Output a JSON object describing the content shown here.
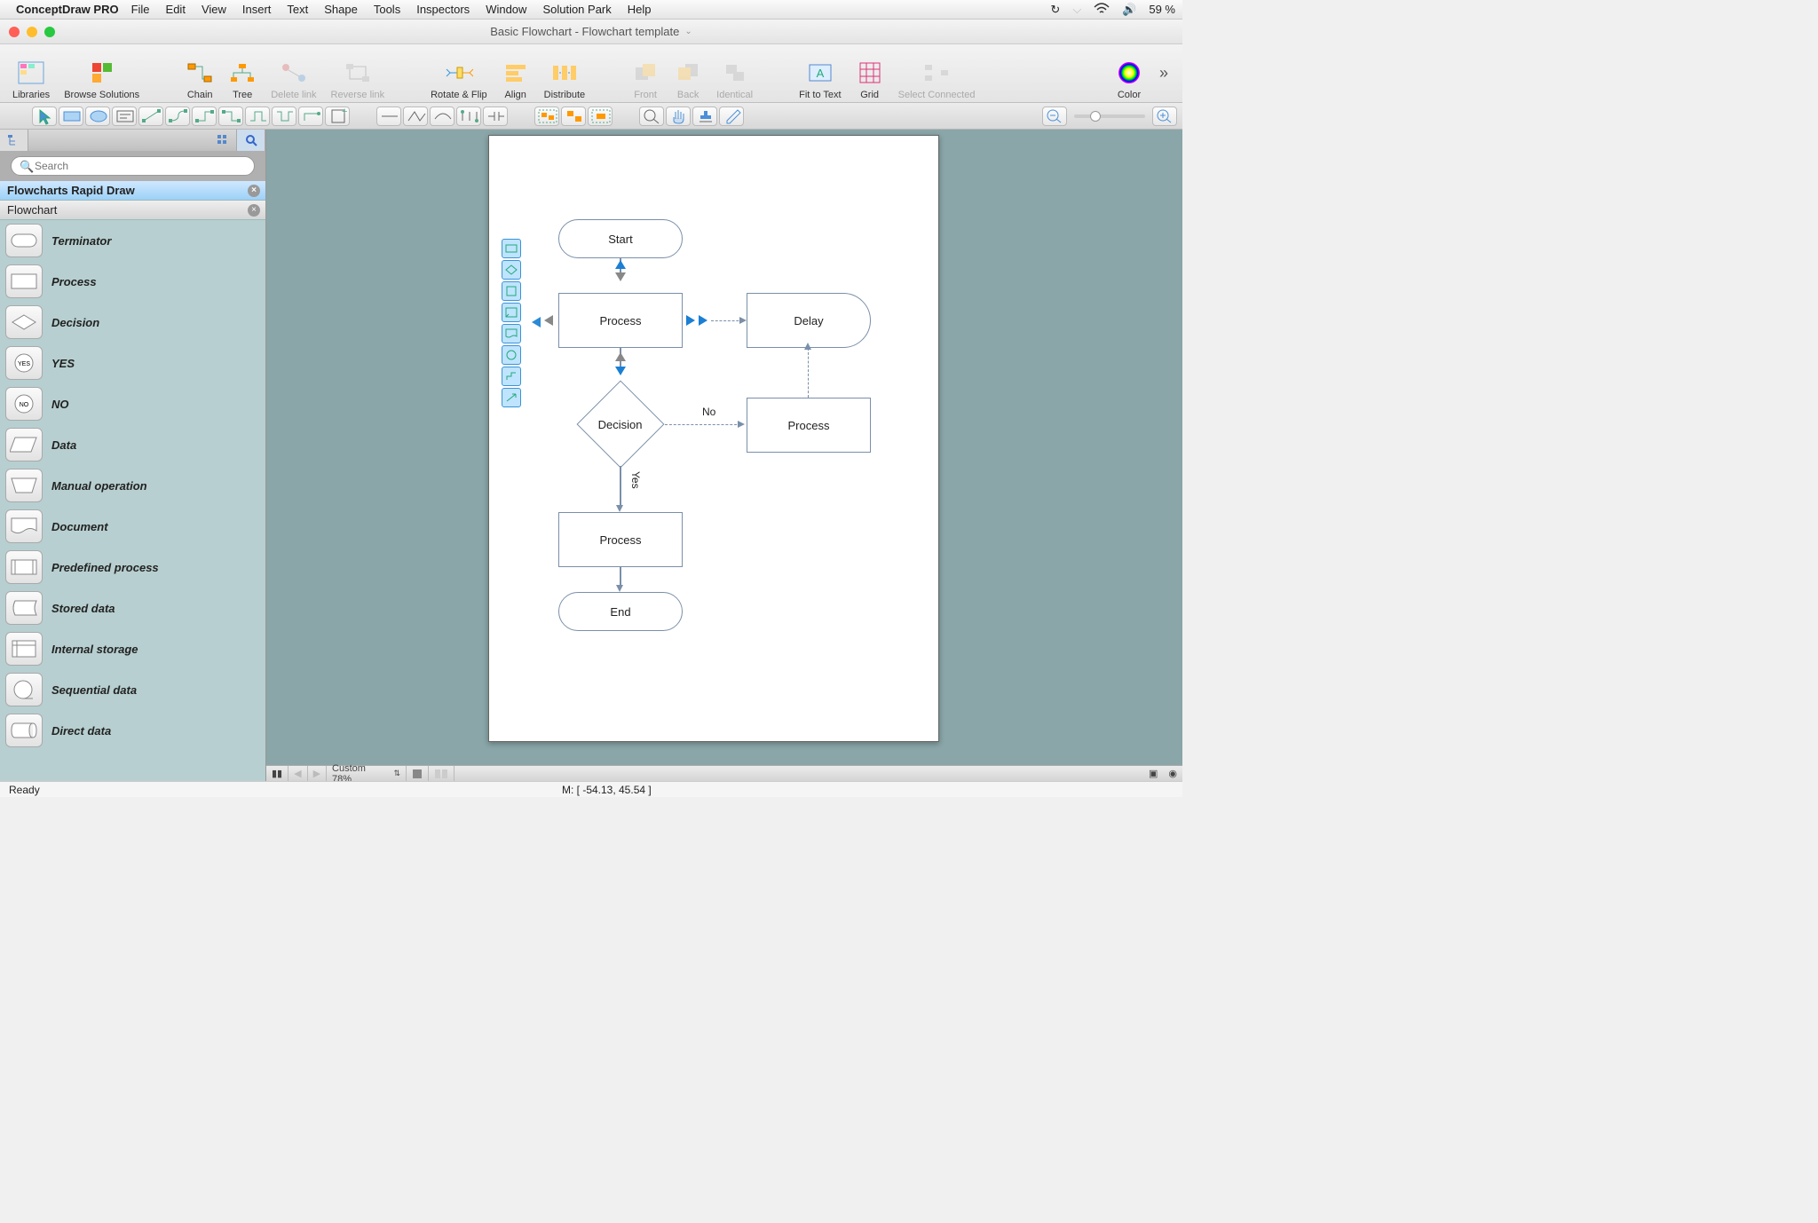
{
  "menubar": {
    "app": "ConceptDraw PRO",
    "items": [
      "File",
      "Edit",
      "View",
      "Insert",
      "Text",
      "Shape",
      "Tools",
      "Inspectors",
      "Window",
      "Solution Park",
      "Help"
    ],
    "battery": "59 %"
  },
  "titlebar": {
    "title": "Basic Flowchart - Flowchart template"
  },
  "toolbar": {
    "libraries": "Libraries",
    "browse": "Browse Solutions",
    "chain": "Chain",
    "tree": "Tree",
    "delete_link": "Delete link",
    "reverse_link": "Reverse link",
    "rotate_flip": "Rotate & Flip",
    "align": "Align",
    "distribute": "Distribute",
    "front": "Front",
    "back": "Back",
    "identical": "Identical",
    "fit_text": "Fit to Text",
    "grid": "Grid",
    "select_connected": "Select Connected",
    "color": "Color"
  },
  "sidebar": {
    "search_placeholder": "Search",
    "lib_active": "Flowcharts Rapid Draw",
    "lib_inactive": "Flowchart",
    "shapes": [
      "Terminator",
      "Process",
      "Decision",
      "YES",
      "NO",
      "Data",
      "Manual operation",
      "Document",
      "Predefined process",
      "Stored data",
      "Internal storage",
      "Sequential data",
      "Direct data"
    ]
  },
  "flowchart": {
    "start": "Start",
    "process1": "Process",
    "delay": "Delay",
    "decision": "Decision",
    "no": "No",
    "yes": "Yes",
    "process2": "Process",
    "process3": "Process",
    "end": "End"
  },
  "bottom": {
    "zoom_label": "Custom 78%"
  },
  "status": {
    "ready": "Ready",
    "mouse": "M: [ -54.13, 45.54 ]"
  }
}
